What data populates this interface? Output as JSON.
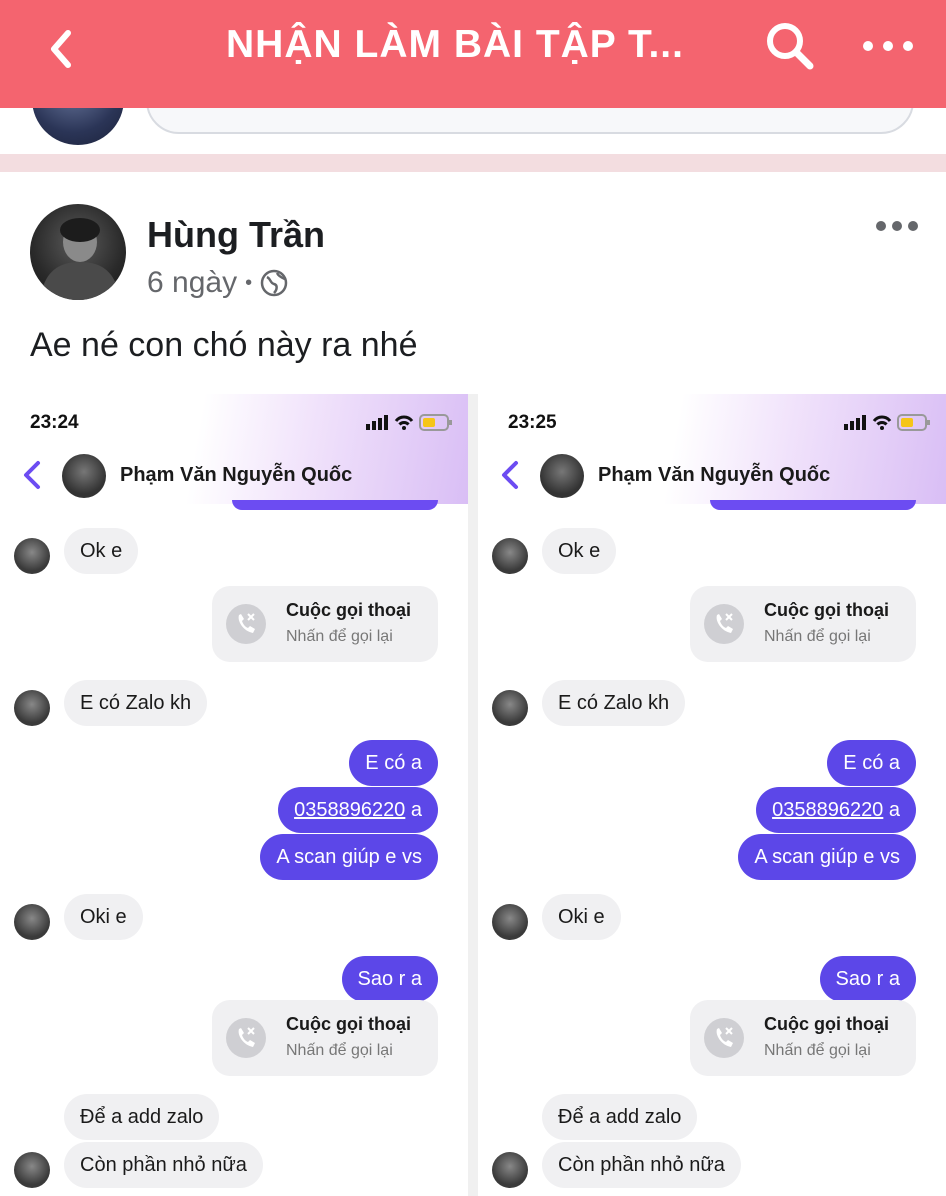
{
  "header": {
    "title": "NHẬN LÀM BÀI TẬP T...",
    "back_icon": "chevron-left-icon",
    "search_icon": "search-icon",
    "more_icon": "more-horizontal-icon",
    "color": "#f4646f"
  },
  "post": {
    "author": "Hùng Trần",
    "time": "6 ngày",
    "separator": "•",
    "privacy_icon": "globe-icon",
    "text": "Ae né con chó này ra nhé"
  },
  "screenshots": [
    {
      "time": "23:24",
      "contact": "Phạm Văn Nguyễn Quốc",
      "messages": {
        "m1": "Ok e",
        "call1_title": "Cuộc gọi thoại",
        "call1_sub": "Nhấn để gọi lại",
        "m2": "E có Zalo kh",
        "m3": "E có a",
        "m4_phone": "0358896220",
        "m4_suffix": " a",
        "m5": "A scan giúp e vs",
        "m6": "Oki e",
        "m7": "Sao r a",
        "call2_title": "Cuộc gọi thoại",
        "call2_sub": "Nhấn để gọi lại",
        "m8": "Để a add zalo",
        "m9": "Còn phần nhỏ nữa"
      }
    },
    {
      "time": "23:25",
      "contact": "Phạm Văn Nguyễn Quốc",
      "messages": {
        "m1": "Ok e",
        "call1_title": "Cuộc gọi thoại",
        "call1_sub": "Nhấn để gọi lại",
        "m2": "E có Zalo kh",
        "m3": "E có a",
        "m4_phone": "0358896220",
        "m4_suffix": " a",
        "m5": "A scan giúp e vs",
        "m6": "Oki e",
        "m7": "Sao r a",
        "call2_title": "Cuộc gọi thoại",
        "call2_sub": "Nhấn để gọi lại",
        "m8": "Để a add zalo",
        "m9": "Còn phần nhỏ nữa"
      }
    }
  ],
  "colors": {
    "outgoing_bubble": "#5c47e8",
    "incoming_bubble": "#f0f0f2"
  }
}
